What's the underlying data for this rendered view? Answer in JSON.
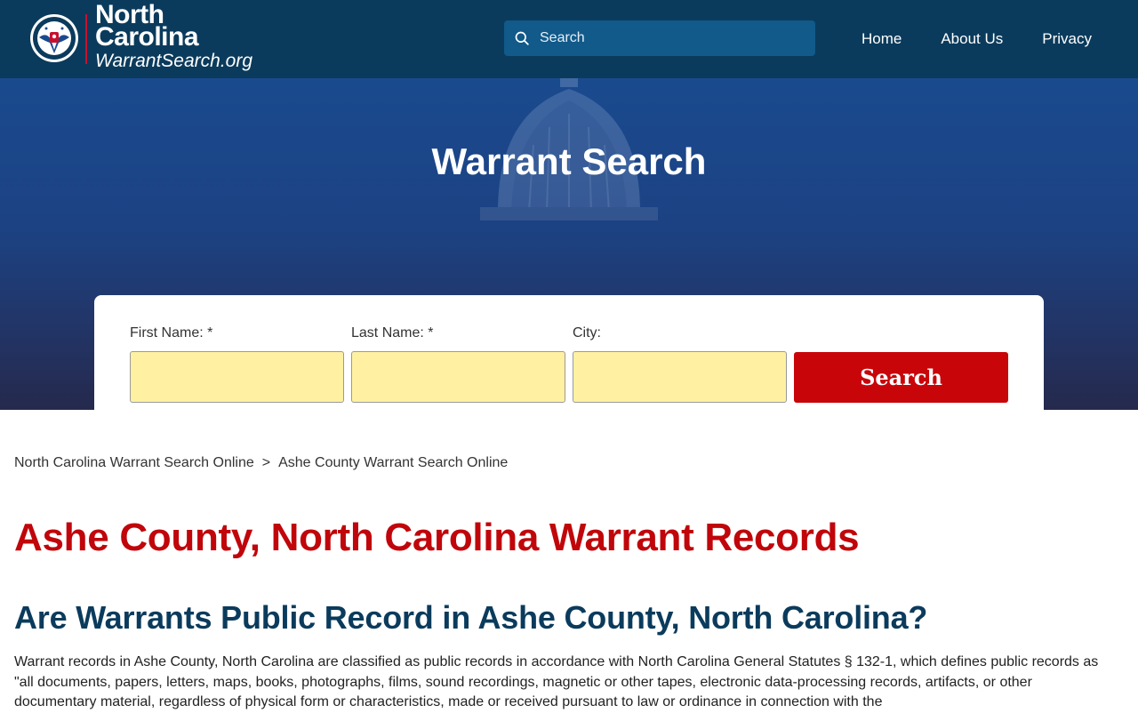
{
  "header": {
    "brand_line1": "North",
    "brand_line2": "Carolina",
    "brand_sub": "WarrantSearch.org",
    "logo_top_text": "WARRANT",
    "logo_bottom_text": "SEARCH",
    "search_placeholder": "Search",
    "nav": [
      "Home",
      "About Us",
      "Privacy"
    ]
  },
  "hero": {
    "title": "Warrant Search",
    "form": {
      "first_name_label": "First Name: *",
      "last_name_label": "Last Name: *",
      "city_label": "City:",
      "first_name_value": "",
      "last_name_value": "",
      "city_value": "",
      "submit_label": "Search"
    }
  },
  "breadcrumb": {
    "items": [
      "North Carolina Warrant Search Online",
      "Ashe County Warrant Search Online"
    ],
    "separator": ">"
  },
  "main": {
    "title": "Ashe County, North Carolina Warrant Records",
    "section_heading": "Are Warrants Public Record in Ashe County, North Carolina?",
    "paragraph": "Warrant records in Ashe County, North Carolina are classified as public records in accordance with North Carolina General Statutes § 132-1, which defines public records as \"all documents, papers, letters, maps, books, photographs, films, sound recordings, magnetic or other tapes, electronic data-processing records, artifacts, or other documentary material, regardless of physical form or characteristics, made or received pursuant to law or ordinance in connection with the"
  },
  "colors": {
    "header_bg": "#0b3b5c",
    "search_bg": "#115a8a",
    "accent_red": "#c8060a",
    "input_yellow": "#fff1a1",
    "heading_navy": "#0b3b5c"
  },
  "icons": [
    "warrant-search-logo-icon",
    "search-icon"
  ]
}
